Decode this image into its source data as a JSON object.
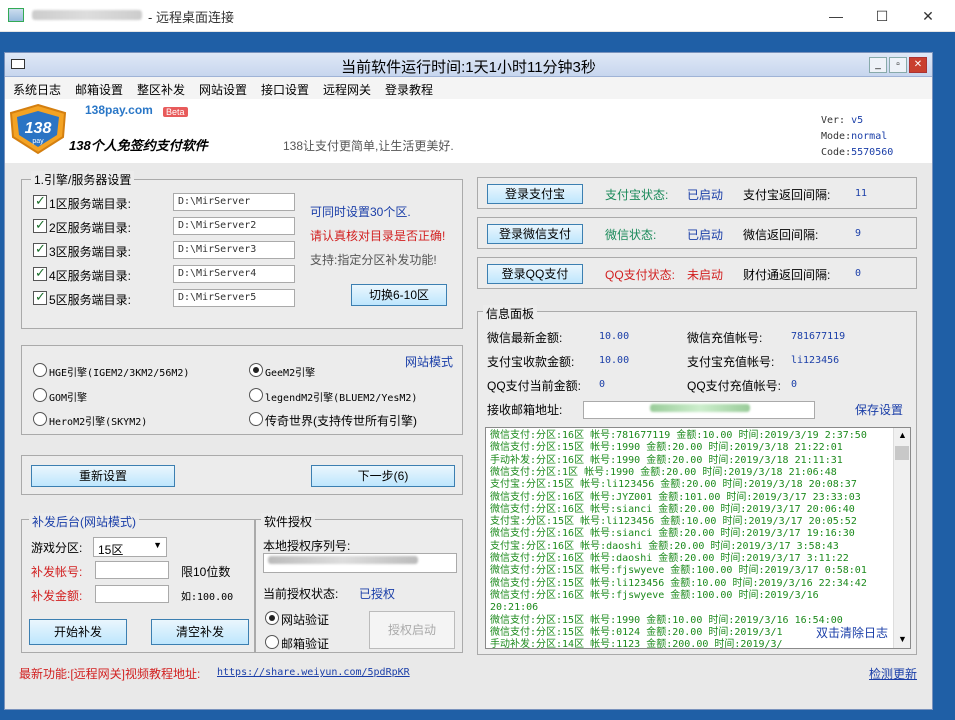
{
  "rdp": {
    "title": "- 远程桌面连接",
    "minimize": "—",
    "maximize": "☐",
    "close": "✕"
  },
  "app": {
    "title": "当前软件运行时间:1天1小时11分钟3秒",
    "controls": [
      "_",
      "▫",
      "✕"
    ],
    "menu": [
      "系统日志",
      "邮箱设置",
      "整区补发",
      "网站设置",
      "接口设置",
      "远程网关",
      "登录教程"
    ]
  },
  "header": {
    "logo_text": "138",
    "logo_sub": "pay",
    "site": "138pay.com",
    "beta": "Beta",
    "product": "138个人免签约支付软件",
    "slogan": "138让支付更简单,让生活更美好.",
    "ver_label": "Ver:",
    "ver": "v5",
    "mode_label": "Mode:",
    "mode": "normal",
    "code_label": "Code:",
    "code": "5570560"
  },
  "server": {
    "legend": "1.引擎/服务器设置",
    "rows": [
      {
        "label": "1区服务端目录:",
        "path": "D:\\MirServer",
        "checked": true
      },
      {
        "label": "2区服务端目录:",
        "path": "D:\\MirServer2",
        "checked": true
      },
      {
        "label": "3区服务端目录:",
        "path": "D:\\MirServer3",
        "checked": true
      },
      {
        "label": "4区服务端目录:",
        "path": "D:\\MirServer4",
        "checked": true
      },
      {
        "label": "5区服务端目录:",
        "path": "D:\\MirServer5",
        "checked": true
      }
    ],
    "note1": "可同时设置30个区.",
    "note2": "请认真核对目录是否正确!",
    "note3": "支持:指定分区补发功能!",
    "switch_btn": "切换6-10区"
  },
  "engine": {
    "website_mode": "网站模式",
    "options": [
      "HGE引擎(IGEM2/3KM2/56M2)",
      "GeeM2引擎",
      "GOM引擎",
      "legendM2引擎(BLUEM2/YesM2)",
      "HeroM2引擎(SKYM2)",
      "传奇世界(支持传世所有引擎)"
    ],
    "selected": "GeeM2引擎"
  },
  "actions": {
    "reset": "重新设置",
    "next": "下一步(6)"
  },
  "resend": {
    "legend": "补发后台(网站模式)",
    "zone_label": "游戏分区:",
    "zone_value": "15区",
    "account_label": "补发帐号:",
    "account_hint": "限10位数",
    "amount_label": "补发金额:",
    "amount_hint": "如:100.00",
    "start_btn": "开始补发",
    "clear_btn": "清空补发"
  },
  "license": {
    "legend": "软件授权",
    "serial_label": "本地授权序列号:",
    "status_label": "当前授权状态:",
    "status_value": "已授权",
    "opt_web": "网站验证",
    "opt_mail": "邮箱验证",
    "activate_btn": "授权启动"
  },
  "footer": {
    "latest": "最新功能:[远程网关]视频教程地址:",
    "url": "https://share.weiyun.com/5pdRpKR",
    "check_update": "检测更新"
  },
  "payments": [
    {
      "button": "登录支付宝",
      "status_label": "支付宝状态:",
      "status": "已启动",
      "status_color": "#1a3ea8",
      "interval_label": "支付宝返回间隔:",
      "interval": "11"
    },
    {
      "button": "登录微信支付",
      "status_label": "微信状态:",
      "status": "已启动",
      "status_color": "#1a3ea8",
      "interval_label": "微信返回间隔:",
      "interval": "9"
    },
    {
      "button": "登录QQ支付",
      "status_label": "QQ支付状态:",
      "status": "未启动",
      "status_color": "#d21f1f",
      "interval_label": "财付通返回间隔:",
      "interval": "0"
    }
  ],
  "info": {
    "legend": "信息面板",
    "wx_amount_label": "微信最新金额:",
    "wx_amount": "10.00",
    "wx_account_label": "微信充值帐号:",
    "wx_account": "781677119",
    "ali_amount_label": "支付宝收款金额:",
    "ali_amount": "10.00",
    "ali_account_label": "支付宝充值帐号:",
    "ali_account": "li123456",
    "qq_amount_label": "QQ支付当前金额:",
    "qq_amount": "0",
    "qq_account_label": "QQ支付充值帐号:",
    "qq_account": "0",
    "email_label": "接收邮箱地址:",
    "save_settings": "保存设置",
    "clear_log": "双击清除日志"
  },
  "log": [
    "微信支付:分区:16区 帐号:781677119 金额:10.00 时间:2019/3/19 2:37:50",
    "微信支付:分区:15区 帐号:1990 金额:20.00 时间:2019/3/18 21:22:01",
    "手动补发:分区:16区 帐号:1990 金额:20.00 时间:2019/3/18 21:11:31",
    "微信支付:分区:1区 帐号:1990 金额:20.00 时间:2019/3/18 21:06:48",
    "支付宝:分区:15区 帐号:li123456 金额:20.00 时间:2019/3/18 20:08:37",
    "微信支付:分区:16区 帐号:JYZ001 金额:101.00 时间:2019/3/17 23:33:03",
    "微信支付:分区:16区 帐号:sianci 金额:20.00 时间:2019/3/17 20:06:40",
    "支付宝:分区:15区 帐号:li123456 金额:10.00 时间:2019/3/17 20:05:52",
    "微信支付:分区:16区 帐号:sianci 金额:20.00 时间:2019/3/17 19:16:30",
    "支付宝:分区:16区 帐号:daoshi 金额:20.00 时间:2019/3/17 3:58:43",
    "微信支付:分区:16区 帐号:daoshi 金额:20.00 时间:2019/3/17 3:11:22",
    "微信支付:分区:15区 帐号:fjswyeve 金额:100.00 时间:2019/3/17 0:58:01",
    "微信支付:分区:15区 帐号:li123456 金额:10.00 时间:2019/3/16 22:34:42",
    "微信支付:分区:16区 帐号:fjswyeve 金额:100.00 时间:2019/3/16",
    "20:21:06",
    "微信支付:分区:15区 帐号:1990 金额:10.00 时间:2019/3/16 16:54:00",
    "微信支付:分区:15区 帐号:0124 金额:20.00 时间:2019/3/1",
    "手动补发:分区:14区 帐号:1123 金额:200.00 时间:2019/3/"
  ]
}
